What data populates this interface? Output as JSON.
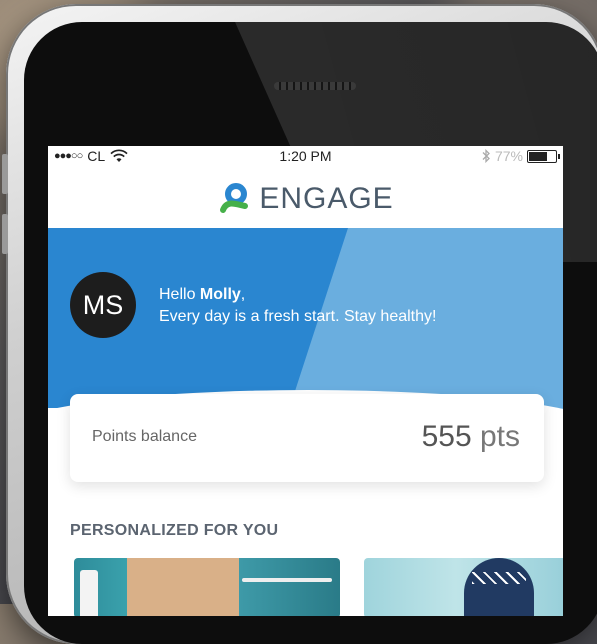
{
  "status_bar": {
    "signal": "●●●○○",
    "carrier": "CL",
    "time": "1:20 PM",
    "battery_pct": "77%",
    "battery_level": 0.77
  },
  "header": {
    "logo_text": "ENGAGE"
  },
  "hero": {
    "avatar_initials": "MS",
    "greeting_prefix": "Hello ",
    "user_name": "Molly",
    "greeting_suffix": ",",
    "tagline": "Every day is a fresh start. Stay healthy!"
  },
  "points": {
    "label": "Points balance",
    "value": "555",
    "unit": " pts"
  },
  "personalized": {
    "title": "PERSONALIZED FOR YOU"
  },
  "colors": {
    "brand_blue": "#2a86d0",
    "brand_light_blue": "#6aaedf",
    "logo_green": "#46b04a",
    "logo_blue": "#2a86d0"
  },
  "icons": {
    "wifi": "wifi-icon",
    "bluetooth": "bluetooth-icon",
    "battery": "battery-icon",
    "logo": "engage-logo-icon"
  }
}
